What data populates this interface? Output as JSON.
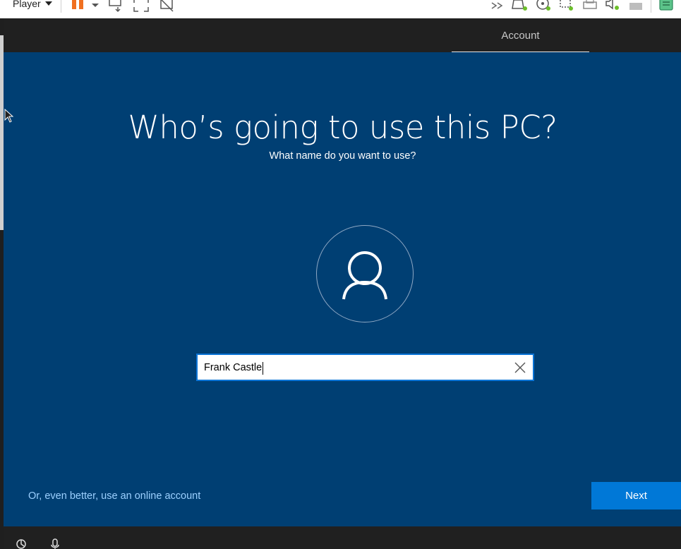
{
  "toolbar": {
    "player_label": "Player",
    "icons": [
      "pause-icon",
      "chevron-down-icon",
      "send-keys-icon",
      "fullscreen-icon",
      "unity-icon",
      "more-icon",
      "hard-disk-icon",
      "cd-drive-icon",
      "network-icon",
      "printer-icon",
      "sound-icon",
      "usb-icon",
      "notes-icon"
    ]
  },
  "oobe": {
    "tab_label": "Account",
    "title": "Who’s going to use this PC?",
    "subtitle": "What name do you want to use?",
    "name_input": {
      "value": "Frank Castle"
    },
    "online_account_link": "Or, even better, use an online account",
    "next_label": "Next",
    "bottom_icons": [
      "ease-of-access-icon",
      "microphone-icon"
    ]
  },
  "colors": {
    "background": "#003f73",
    "accent": "#0078d7",
    "link": "#9cd0ff"
  }
}
